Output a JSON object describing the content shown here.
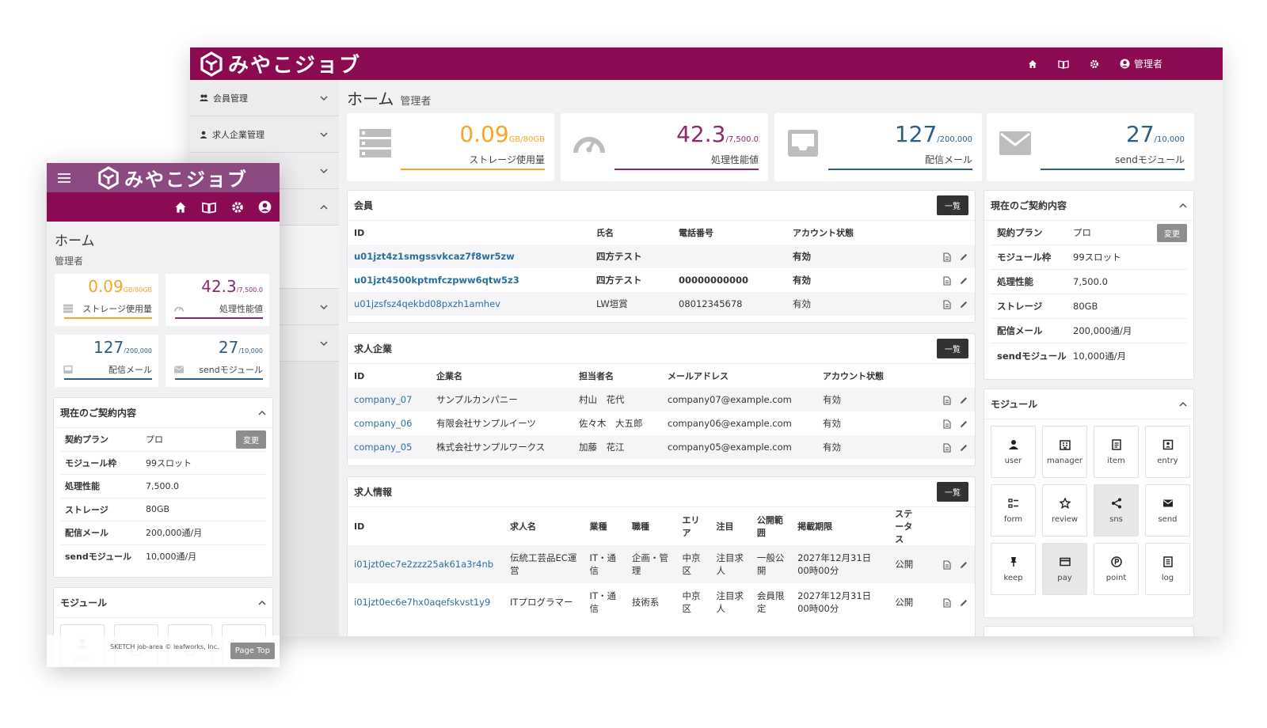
{
  "desktop": {
    "brand": "みやこジョブ",
    "nav": {
      "user_label": "管理者"
    },
    "sidebar": [
      {
        "label": "会員管理"
      },
      {
        "label": "求人企業管理"
      }
    ],
    "page_title": "ホーム",
    "page_subtitle": "管理者",
    "stats": [
      {
        "value": "0.09",
        "unit": "GB/80GB",
        "label": "ストレージ使用量",
        "color": "#f5a623",
        "progress": 0.0011
      },
      {
        "value": "42.3",
        "unit": "/7,500.0",
        "label": "処理性能値",
        "color": "#8a2a6d",
        "progress": 0.0056
      },
      {
        "value": "127",
        "unit": "/200,000",
        "label": "配信メール",
        "color": "#2c5d85",
        "progress": 0.0006
      },
      {
        "value": "27",
        "unit": "/10,000",
        "label": "sendモジュール",
        "color": "#2c5d85",
        "progress": 0.0027
      }
    ],
    "members": {
      "title": "会員",
      "button": "一覧",
      "headers": [
        "ID",
        "氏名",
        "電話番号",
        "アカウント状態"
      ],
      "rows": [
        {
          "id": "u01jzt4z1smgssvkcaz7f8wr5zw",
          "name": "四方テスト",
          "phone": "",
          "status": "有効"
        },
        {
          "id": "u01jzt4500kptmfczpww6qtw5z3",
          "name": "四方テスト",
          "phone": "00000000000",
          "status": "有効"
        },
        {
          "id": "u01jzsfsz4qekbd08pxzh1amhev",
          "name": "LW垣賞",
          "phone": "08012345678",
          "status": "有効"
        }
      ]
    },
    "companies": {
      "title": "求人企業",
      "button": "一覧",
      "headers": [
        "ID",
        "企業名",
        "担当者名",
        "メールアドレス",
        "アカウント状態"
      ],
      "rows": [
        {
          "id": "company_07",
          "name": "サンプルカンパニー",
          "contact": "村山　花代",
          "email": "company07@example.com",
          "status": "有効"
        },
        {
          "id": "company_06",
          "name": "有限会社サンプルイーツ",
          "contact": "佐々木　大五郎",
          "email": "company06@example.com",
          "status": "有効"
        },
        {
          "id": "company_05",
          "name": "株式会社サンプルワークス",
          "contact": "加藤　花江",
          "email": "company05@example.com",
          "status": "有効"
        }
      ]
    },
    "jobs": {
      "title": "求人情報",
      "button": "一覧",
      "headers": [
        "ID",
        "求人名",
        "業種",
        "職種",
        "エリア",
        "注目",
        "公開範囲",
        "掲載期限",
        "ステータス"
      ],
      "rows": [
        {
          "id": "i01jzt0ec7e2zzz25ak61a3r4nb",
          "name": "伝統工芸品EC運営",
          "industry": "IT・通信",
          "job": "企画・管理",
          "area": "中京区",
          "featured": "注目求人",
          "scope": "一般公開",
          "deadline": "2027年12月31日00時00分",
          "status": "公開"
        },
        {
          "id": "i01jzt0ec6e7hx0aqefskvst1y9",
          "name": "ITプログラマー",
          "industry": "IT・通信",
          "job": "技術系",
          "area": "中京区",
          "featured": "注目求人",
          "scope": "会員限定",
          "deadline": "2027年12月31日00時00分",
          "status": "公開"
        }
      ]
    },
    "contract": {
      "title": "現在のご契約内容",
      "change_button": "変更",
      "rows": [
        {
          "key": "契約プラン",
          "value": "プロ"
        },
        {
          "key": "モジュール枠",
          "value": "99スロット"
        },
        {
          "key": "処理性能",
          "value": "7,500.0"
        },
        {
          "key": "ストレージ",
          "value": "80GB"
        },
        {
          "key": "配信メール",
          "value": "200,000通/月"
        },
        {
          "key": "sendモジュール",
          "value": "10,000通/月"
        }
      ]
    },
    "modules": {
      "title": "モジュール",
      "items": [
        {
          "label": "user",
          "icon": "user-icon"
        },
        {
          "label": "manager",
          "icon": "building-icon"
        },
        {
          "label": "item",
          "icon": "document-icon"
        },
        {
          "label": "entry",
          "icon": "entry-icon"
        },
        {
          "label": "form",
          "icon": "form-icon"
        },
        {
          "label": "review",
          "icon": "star-icon"
        },
        {
          "label": "sns",
          "icon": "share-icon"
        },
        {
          "label": "send",
          "icon": "mail-icon"
        },
        {
          "label": "keep",
          "icon": "pin-icon"
        },
        {
          "label": "pay",
          "icon": "card-icon"
        },
        {
          "label": "point",
          "icon": "point-icon"
        },
        {
          "label": "log",
          "icon": "log-icon"
        }
      ]
    }
  },
  "mobile": {
    "brand": "みやこジョブ",
    "page_title": "ホーム",
    "page_subtitle": "管理者",
    "contract_title": "現在のご契約内容",
    "modules_title": "モジュール",
    "module_labels": [
      "user"
    ],
    "footer": "SKETCH job-area © leafworks, Inc.",
    "page_top": "Page Top"
  },
  "colors": {
    "brand": "#8b0b52",
    "brand_light": "#8b4a82",
    "link": "#2b6f9c"
  }
}
